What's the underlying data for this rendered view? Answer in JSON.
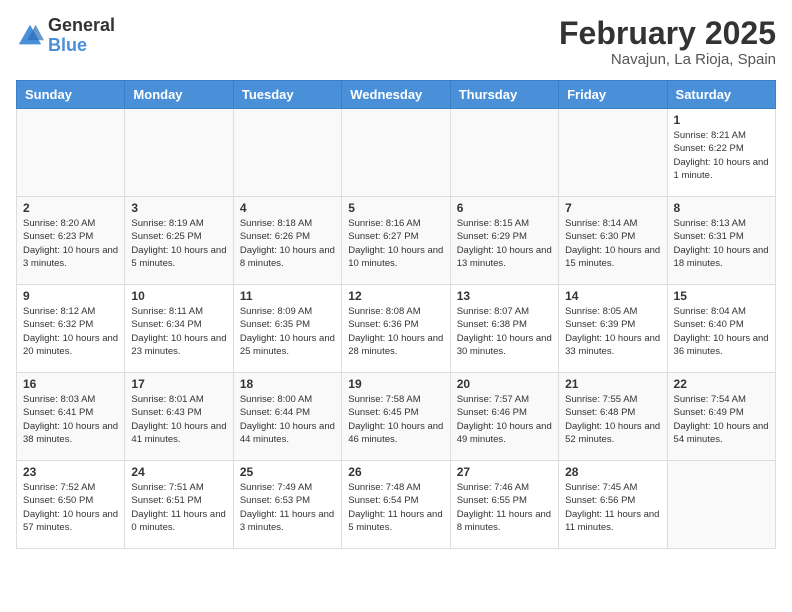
{
  "header": {
    "logo": {
      "general": "General",
      "blue": "Blue"
    },
    "month_year": "February 2025",
    "location": "Navajun, La Rioja, Spain"
  },
  "days_of_week": [
    "Sunday",
    "Monday",
    "Tuesday",
    "Wednesday",
    "Thursday",
    "Friday",
    "Saturday"
  ],
  "weeks": [
    [
      {
        "empty": true
      },
      {
        "empty": true
      },
      {
        "empty": true
      },
      {
        "empty": true
      },
      {
        "empty": true
      },
      {
        "empty": true
      },
      {
        "day": 1,
        "sunrise": "8:21 AM",
        "sunset": "6:22 PM",
        "daylight": "10 hours and 1 minute."
      }
    ],
    [
      {
        "day": 2,
        "sunrise": "8:20 AM",
        "sunset": "6:23 PM",
        "daylight": "10 hours and 3 minutes."
      },
      {
        "day": 3,
        "sunrise": "8:19 AM",
        "sunset": "6:25 PM",
        "daylight": "10 hours and 5 minutes."
      },
      {
        "day": 4,
        "sunrise": "8:18 AM",
        "sunset": "6:26 PM",
        "daylight": "10 hours and 8 minutes."
      },
      {
        "day": 5,
        "sunrise": "8:16 AM",
        "sunset": "6:27 PM",
        "daylight": "10 hours and 10 minutes."
      },
      {
        "day": 6,
        "sunrise": "8:15 AM",
        "sunset": "6:29 PM",
        "daylight": "10 hours and 13 minutes."
      },
      {
        "day": 7,
        "sunrise": "8:14 AM",
        "sunset": "6:30 PM",
        "daylight": "10 hours and 15 minutes."
      },
      {
        "day": 8,
        "sunrise": "8:13 AM",
        "sunset": "6:31 PM",
        "daylight": "10 hours and 18 minutes."
      }
    ],
    [
      {
        "day": 9,
        "sunrise": "8:12 AM",
        "sunset": "6:32 PM",
        "daylight": "10 hours and 20 minutes."
      },
      {
        "day": 10,
        "sunrise": "8:11 AM",
        "sunset": "6:34 PM",
        "daylight": "10 hours and 23 minutes."
      },
      {
        "day": 11,
        "sunrise": "8:09 AM",
        "sunset": "6:35 PM",
        "daylight": "10 hours and 25 minutes."
      },
      {
        "day": 12,
        "sunrise": "8:08 AM",
        "sunset": "6:36 PM",
        "daylight": "10 hours and 28 minutes."
      },
      {
        "day": 13,
        "sunrise": "8:07 AM",
        "sunset": "6:38 PM",
        "daylight": "10 hours and 30 minutes."
      },
      {
        "day": 14,
        "sunrise": "8:05 AM",
        "sunset": "6:39 PM",
        "daylight": "10 hours and 33 minutes."
      },
      {
        "day": 15,
        "sunrise": "8:04 AM",
        "sunset": "6:40 PM",
        "daylight": "10 hours and 36 minutes."
      }
    ],
    [
      {
        "day": 16,
        "sunrise": "8:03 AM",
        "sunset": "6:41 PM",
        "daylight": "10 hours and 38 minutes."
      },
      {
        "day": 17,
        "sunrise": "8:01 AM",
        "sunset": "6:43 PM",
        "daylight": "10 hours and 41 minutes."
      },
      {
        "day": 18,
        "sunrise": "8:00 AM",
        "sunset": "6:44 PM",
        "daylight": "10 hours and 44 minutes."
      },
      {
        "day": 19,
        "sunrise": "7:58 AM",
        "sunset": "6:45 PM",
        "daylight": "10 hours and 46 minutes."
      },
      {
        "day": 20,
        "sunrise": "7:57 AM",
        "sunset": "6:46 PM",
        "daylight": "10 hours and 49 minutes."
      },
      {
        "day": 21,
        "sunrise": "7:55 AM",
        "sunset": "6:48 PM",
        "daylight": "10 hours and 52 minutes."
      },
      {
        "day": 22,
        "sunrise": "7:54 AM",
        "sunset": "6:49 PM",
        "daylight": "10 hours and 54 minutes."
      }
    ],
    [
      {
        "day": 23,
        "sunrise": "7:52 AM",
        "sunset": "6:50 PM",
        "daylight": "10 hours and 57 minutes."
      },
      {
        "day": 24,
        "sunrise": "7:51 AM",
        "sunset": "6:51 PM",
        "daylight": "11 hours and 0 minutes."
      },
      {
        "day": 25,
        "sunrise": "7:49 AM",
        "sunset": "6:53 PM",
        "daylight": "11 hours and 3 minutes."
      },
      {
        "day": 26,
        "sunrise": "7:48 AM",
        "sunset": "6:54 PM",
        "daylight": "11 hours and 5 minutes."
      },
      {
        "day": 27,
        "sunrise": "7:46 AM",
        "sunset": "6:55 PM",
        "daylight": "11 hours and 8 minutes."
      },
      {
        "day": 28,
        "sunrise": "7:45 AM",
        "sunset": "6:56 PM",
        "daylight": "11 hours and 11 minutes."
      },
      {
        "empty": true
      }
    ]
  ]
}
